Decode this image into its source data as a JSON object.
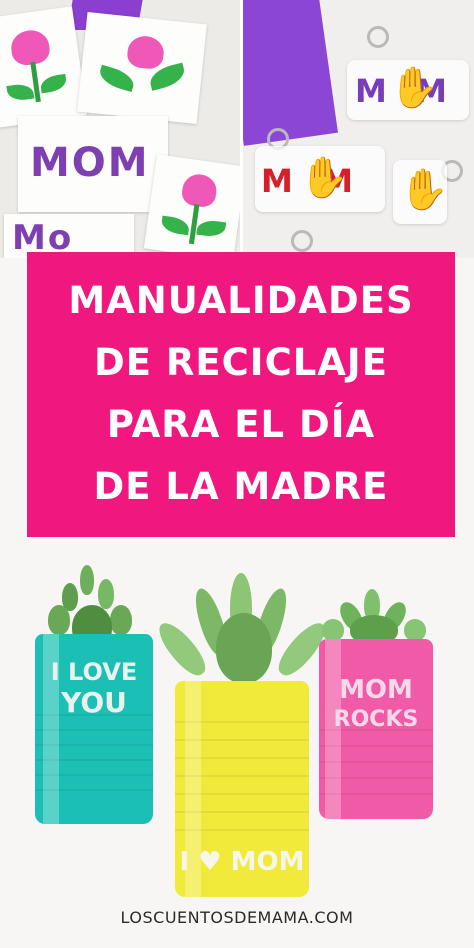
{
  "collage": {
    "left_card_top_label": "MOM",
    "left_card_bottom_partial": "Mo",
    "keychain_labels": [
      "M  M",
      "M  M"
    ]
  },
  "banner": {
    "lines": [
      "MANUALIDADES",
      "DE RECICLAJE",
      "PARA EL DÍA",
      "DE LA MADRE"
    ],
    "background_color": "#f0187f"
  },
  "cans": {
    "teal": {
      "lines": [
        "I LOVE",
        "YOU"
      ],
      "color": "#1bbfb4"
    },
    "yellow": {
      "text": "I ♥ MOM",
      "color": "#f2ea3a"
    },
    "pink": {
      "lines": [
        "MOM",
        "ROCKS"
      ],
      "color": "#f05aa6"
    }
  },
  "footer": {
    "site": "LOSCUENTOSDEMAMA.COM"
  }
}
